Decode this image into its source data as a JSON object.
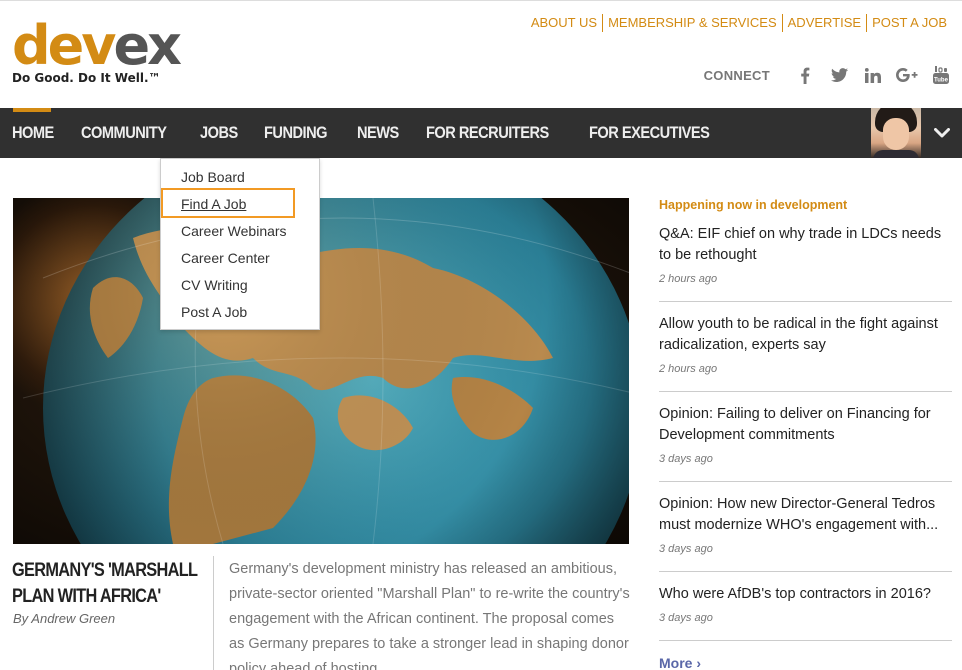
{
  "logo": {
    "wordmark_a": "dev",
    "wordmark_b": "ex",
    "tagline": "Do Good. Do It Well.™"
  },
  "toplinks": [
    "ABOUT US",
    "MEMBERSHIP & SERVICES",
    "ADVERTISE",
    "POST A JOB"
  ],
  "connect": {
    "label": "CONNECT",
    "icons": [
      "facebook-icon",
      "twitter-icon",
      "linkedin-icon",
      "google-plus-icon",
      "youtube-icon"
    ],
    "glyphs": [
      "f",
      "🐦",
      "in",
      "G+",
      "▶"
    ]
  },
  "nav": {
    "items": [
      "HOME",
      "COMMUNITY",
      "JOBS",
      "FUNDING",
      "NEWS",
      "FOR RECRUITERS",
      "FOR EXECUTIVES"
    ],
    "active": "HOME",
    "toggle_glyph": "⌄"
  },
  "dropdown": {
    "items": [
      "Job Board",
      "Find A Job",
      "Career Webinars",
      "Career Center",
      "CV Writing",
      "Post A Job"
    ],
    "focused": "Find A Job"
  },
  "feature": {
    "title_line1": "GERMANY'S 'MARSHALL",
    "title_line2": "PLAN WITH AFRICA'",
    "author": "By Andrew Green",
    "body": "Germany's development ministry has released an ambitious, private-sector oriented \"Marshall Plan\" to re-write the country's engagement with the African continent. The proposal comes as Germany prepares to take a stronger lead in shaping donor policy ahead of hosting"
  },
  "sidebar": {
    "heading": "Happening now in development",
    "items": [
      {
        "title": "Q&A: EIF chief on why trade in LDCs needs to be rethought",
        "time": "2 hours ago"
      },
      {
        "title": "Allow youth to be radical in the fight against radicalization, experts say",
        "time": "2 hours ago"
      },
      {
        "title": "Opinion: Failing to deliver on Financing for Development commitments",
        "time": "3 days ago"
      },
      {
        "title": "Opinion: How new Director-General Tedros must modernize WHO's engagement with...",
        "time": "3 days ago"
      },
      {
        "title": "Who were AfDB's top contractors in 2016?",
        "time": "3 days ago"
      }
    ],
    "more": "More ›"
  },
  "colors": {
    "accent": "#d38b14",
    "nav_bg": "#303030",
    "focus_ring": "#f29a24",
    "more_link": "#5a67a8"
  }
}
